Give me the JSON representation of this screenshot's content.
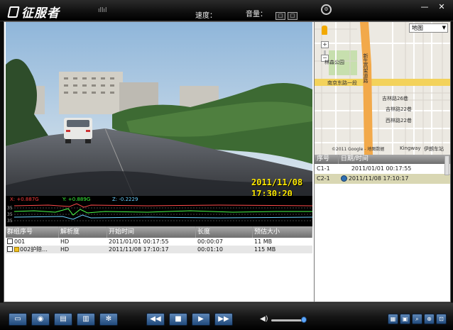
{
  "titlebar": {
    "logo_text": "征服者",
    "signal_text": "ıllıl",
    "speed_label": "速度：",
    "volume_label": "音量：",
    "btn_a": "□",
    "btn_b": "□",
    "window": {
      "minimize": "—",
      "close": "✕"
    }
  },
  "video": {
    "date": "2011/11/08",
    "time": "17:30:20"
  },
  "sensor_graph": {
    "x_label": "X: +0.887G",
    "y_label": "Y: +0.889G",
    "z_label": "Z: -0.2229",
    "y_ticks": [
      "35",
      "35",
      "35"
    ]
  },
  "file_list": {
    "columns": [
      "群组序号",
      "解析度",
      "开始时间",
      "长度",
      "预估大小"
    ],
    "rows": [
      {
        "id": "001",
        "locked": false,
        "resolution": "HD",
        "start": "2011/01/01 00:17:55",
        "length": "00:00:07",
        "size": "11 MB"
      },
      {
        "id": "002护除...",
        "locked": true,
        "resolution": "HD",
        "start": "2011/11/08 17:10:17",
        "length": "00:01:10",
        "size": "115 MB"
      }
    ]
  },
  "map": {
    "type_select": "地图",
    "zoom_in": "+",
    "zoom_out": "−",
    "labels": {
      "park": "林森公园",
      "road_main": "南京东路一段",
      "road_vertical": "新生高架道路",
      "jilin": "吉林路26巷",
      "jilin2": "吉林路22巷",
      "hsi": "西林路22巷",
      "kingway": "Kingway",
      "yinyue": "伊朗车站",
      "footer": "©2011 Google - 地图数据"
    }
  },
  "gps_list": {
    "columns": [
      "序号",
      "日期/时间"
    ],
    "rows": [
      {
        "num": "C1-1",
        "datetime": "2011/01/01 00:17:55",
        "selected": false
      },
      {
        "num": "C2-1",
        "datetime": "2011/11/08 17:10:17",
        "selected": true
      }
    ]
  },
  "controls": {
    "left_icons": [
      "folder",
      "camera",
      "save",
      "trash",
      "settings"
    ],
    "transport": [
      "rewind",
      "stop",
      "play",
      "fast-forward"
    ],
    "volume_level": 0.9,
    "right_icons": [
      "map-view",
      "export",
      "search",
      "magnify",
      "lock"
    ]
  },
  "colors": {
    "accent_blue": "#2f5f99",
    "overlay_yellow": "#ffea00",
    "gps_selected": "#d9d7b3"
  }
}
